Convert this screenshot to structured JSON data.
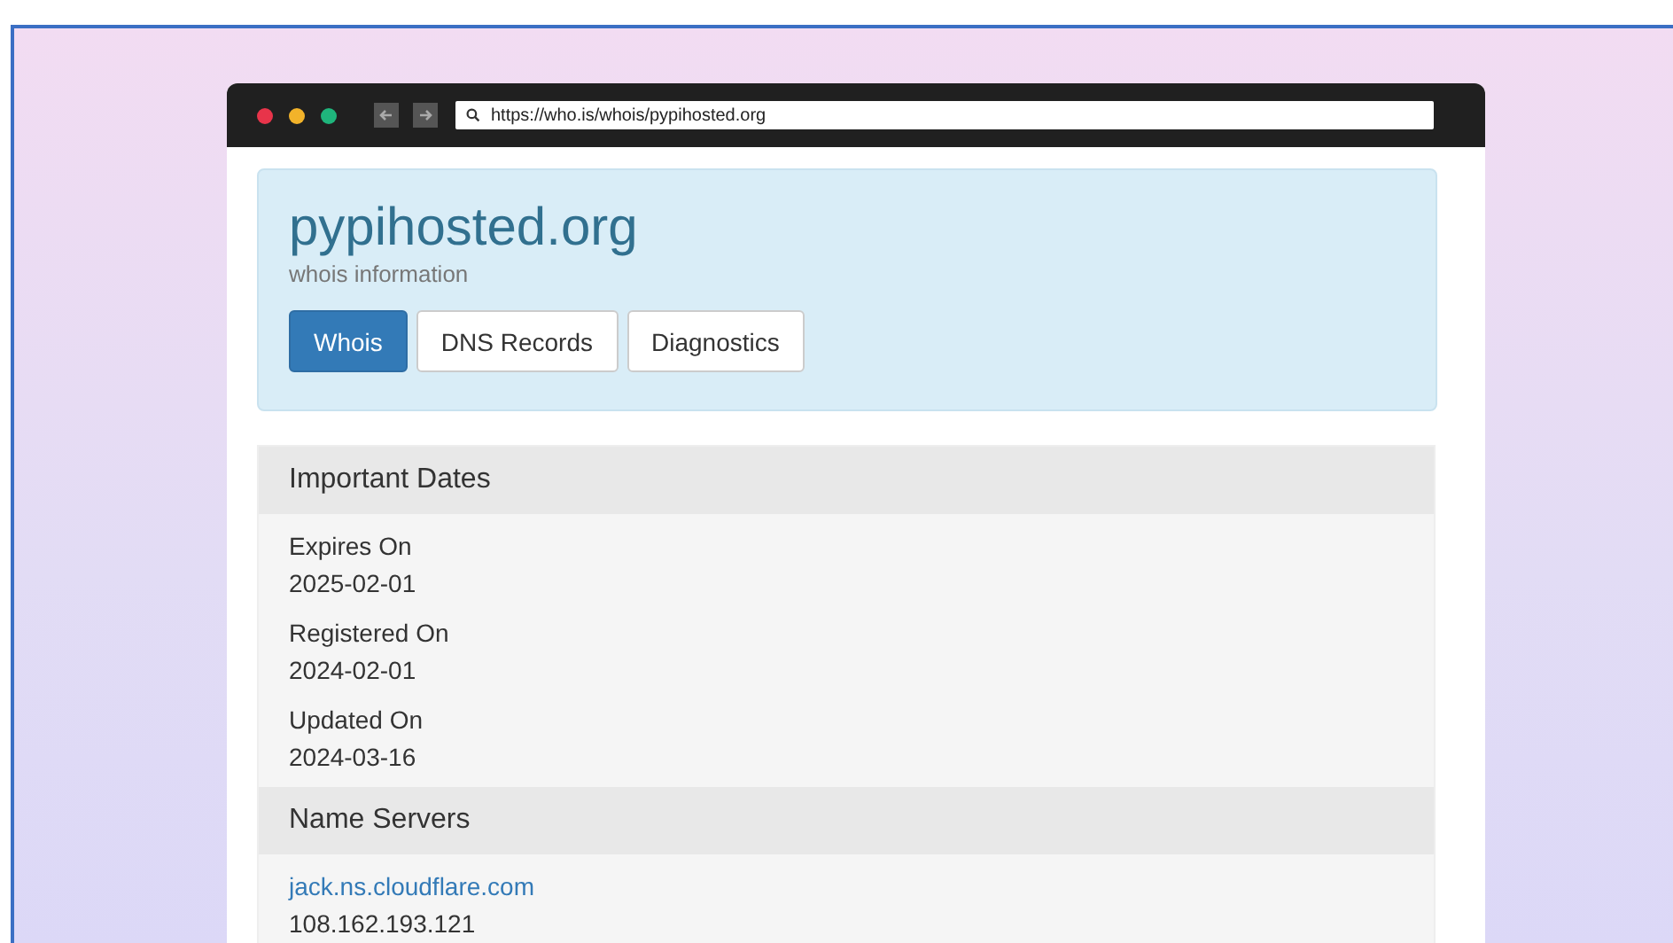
{
  "browser": {
    "url": "https://who.is/whois/pypihosted.org"
  },
  "header": {
    "title": "pypihosted.org",
    "subtitle": "whois information"
  },
  "tabs": [
    {
      "label": "Whois",
      "selected": true
    },
    {
      "label": "DNS Records",
      "selected": false
    },
    {
      "label": "Diagnostics",
      "selected": false
    }
  ],
  "sections": [
    {
      "heading": "Important Dates",
      "items": [
        {
          "kind": "field",
          "label": "Expires On",
          "value": "2025-02-01"
        },
        {
          "kind": "field",
          "label": "Registered On",
          "value": "2024-02-01"
        },
        {
          "kind": "field",
          "label": "Updated On",
          "value": "2024-03-16"
        }
      ]
    },
    {
      "heading": "Name Servers",
      "items": [
        {
          "kind": "server",
          "host": "jack.ns.cloudflare.com",
          "ip": "108.162.193.121"
        }
      ]
    }
  ]
}
